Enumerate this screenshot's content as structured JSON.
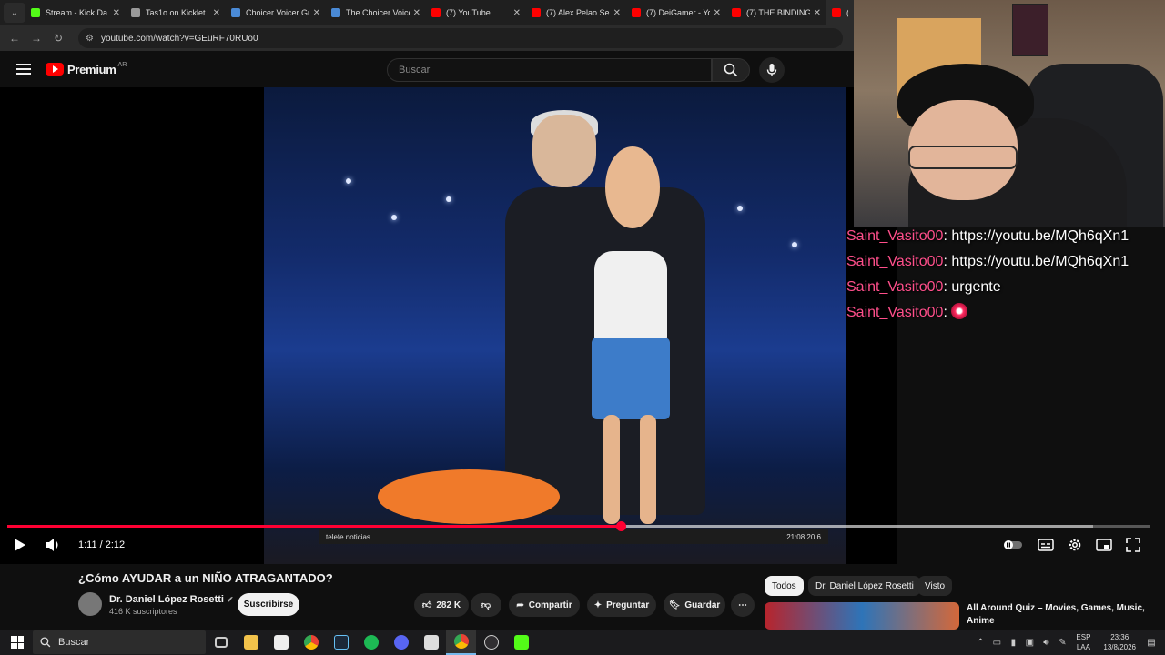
{
  "browser": {
    "tabs": [
      {
        "title": "Stream - Kick Da",
        "color": "#53fc18",
        "active": false
      },
      {
        "title": "Tas1o on Kicklet",
        "color": "#9a9a9a",
        "active": false
      },
      {
        "title": "Choicer Voicer Gu",
        "color": "#4a8ad6",
        "active": false
      },
      {
        "title": "The Choicer Voice",
        "color": "#4a8ad6",
        "active": false
      },
      {
        "title": "(7) YouTube",
        "color": "#ff0000",
        "active": false
      },
      {
        "title": "(7) Alex Pelao Se",
        "color": "#ff0000",
        "active": false
      },
      {
        "title": "(7) DeiGamer - Yo",
        "color": "#ff0000",
        "active": false
      },
      {
        "title": "(7) THE BINDING",
        "color": "#ff0000",
        "active": false
      },
      {
        "title": "(7",
        "color": "#ff0000",
        "active": true
      }
    ],
    "url": "youtube.com/watch?v=GEuRF70RUo0"
  },
  "youtube": {
    "brand": "Premium",
    "country": "AR",
    "search_placeholder": "Buscar"
  },
  "player": {
    "time": "1:11 / 2:12",
    "progress_fraction": 0.537,
    "ticker_left": "telefe noticias",
    "ticker_right": "21:08 20.6"
  },
  "video": {
    "title": "¿Cómo AYUDAR a un NIÑO ATRAGANTADO?",
    "channel": "Dr. Daniel López Rosetti",
    "subscribers": "416 K suscriptores",
    "subscribe_label": "Suscribirse",
    "likes": "282 K",
    "share_label": "Compartir",
    "ask_label": "Preguntar",
    "save_label": "Guardar"
  },
  "recommendations": {
    "chips": [
      "Todos",
      "Dr. Daniel López Rosetti",
      "Visto"
    ],
    "first_title": "All Around Quiz – Movies, Games, Music, Anime"
  },
  "chat": [
    {
      "user": "Saint_Vasito00",
      "message": ": https://youtu.be/MQh6qXn1"
    },
    {
      "user": "Saint_Vasito00",
      "message": ": https://youtu.be/MQh6qXn1"
    },
    {
      "user": "Saint_Vasito00",
      "message": ": urgente"
    },
    {
      "user": "Saint_Vasito00",
      "message": ": "
    }
  ],
  "taskbar": {
    "search_label": "Buscar",
    "lang_line1": "ESP",
    "lang_line2": "LAA",
    "time": "23:36",
    "date": "13/8/2026"
  }
}
